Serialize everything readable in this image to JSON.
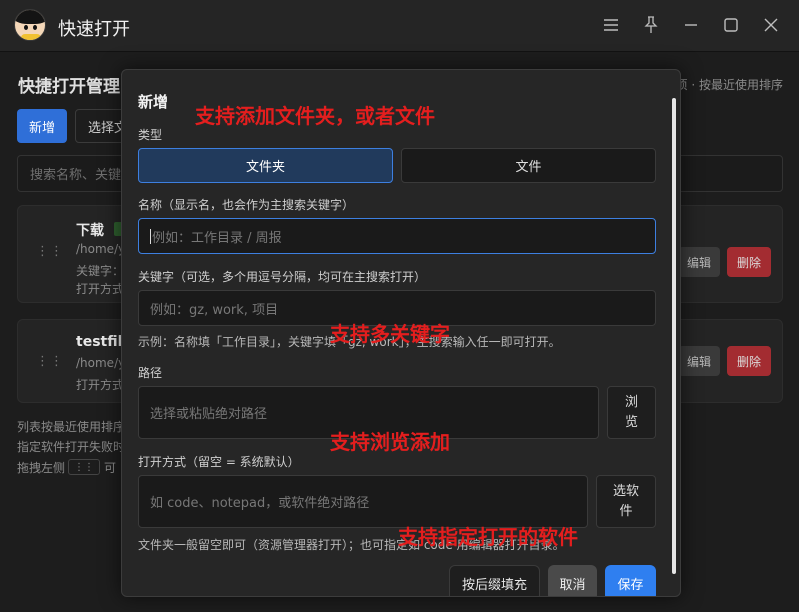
{
  "window": {
    "title": "快速打开",
    "logo_icon": "cartoon-avatar-icon",
    "controls": [
      "menu-icon",
      "pin-icon",
      "minimize-icon",
      "maximize-icon",
      "close-icon"
    ]
  },
  "background": {
    "page_title": "快捷打开管理",
    "sort_hint": "项 · 按最近使用排序",
    "add_button": "新增",
    "choose_button": "选择文",
    "search_placeholder": "搜索名称、关键",
    "items": [
      {
        "name": "下载",
        "path": "/home/y",
        "keywords": "关键字：",
        "open_with": "打开方式",
        "edit": "编辑",
        "delete": "删除"
      },
      {
        "name": "testfile",
        "path": "/home/y",
        "open_with": "打开方式",
        "edit": "编辑",
        "delete": "删除"
      }
    ],
    "footer": {
      "line1": "列表按最近使用排序",
      "line2": "指定软件打开失败时",
      "line3_prefix": "拖拽左侧",
      "kbd": "⋮⋮",
      "line3_suffix": "可"
    }
  },
  "dialog": {
    "title": "新增",
    "type_label": "类型",
    "type_options": [
      "文件夹",
      "文件"
    ],
    "type_selected": "文件夹",
    "name_label": "名称（显示名，也会作为主搜索关键字）",
    "name_placeholder": "例如：工作目录 / 周报",
    "keywords_label": "关键字（可选，多个用逗号分隔，均可在主搜索打开）",
    "keywords_placeholder": "例如：gz, work, 项目",
    "keywords_hint": "示例：名称填「工作目录」，关键字填「gz, work」，主搜索输入任一即可打开。",
    "path_label": "路径",
    "path_placeholder": "选择或粘贴绝对路径",
    "browse_button": "浏览",
    "open_with_label": "打开方式（留空 = 系统默认）",
    "open_with_placeholder": "如 code、notepad，或软件绝对路径",
    "choose_app_button": "选软件",
    "open_with_hint": "文件夹一般留空即可（资源管理器打开）；也可指定如 code 用编辑器打开目录。",
    "fill_by_ext_button": "按后缀填充",
    "cancel_button": "取消",
    "save_button": "保存"
  },
  "annotations": {
    "add_files_folders": "支持添加文件夹，或者文件",
    "multi_keywords": "支持多关键字",
    "browse_add": "支持浏览添加",
    "specify_app": "支持指定打开的软件"
  },
  "colors": {
    "accent": "#2f7ff0",
    "danger": "#a32c31",
    "annotation": "#e41e1e"
  }
}
